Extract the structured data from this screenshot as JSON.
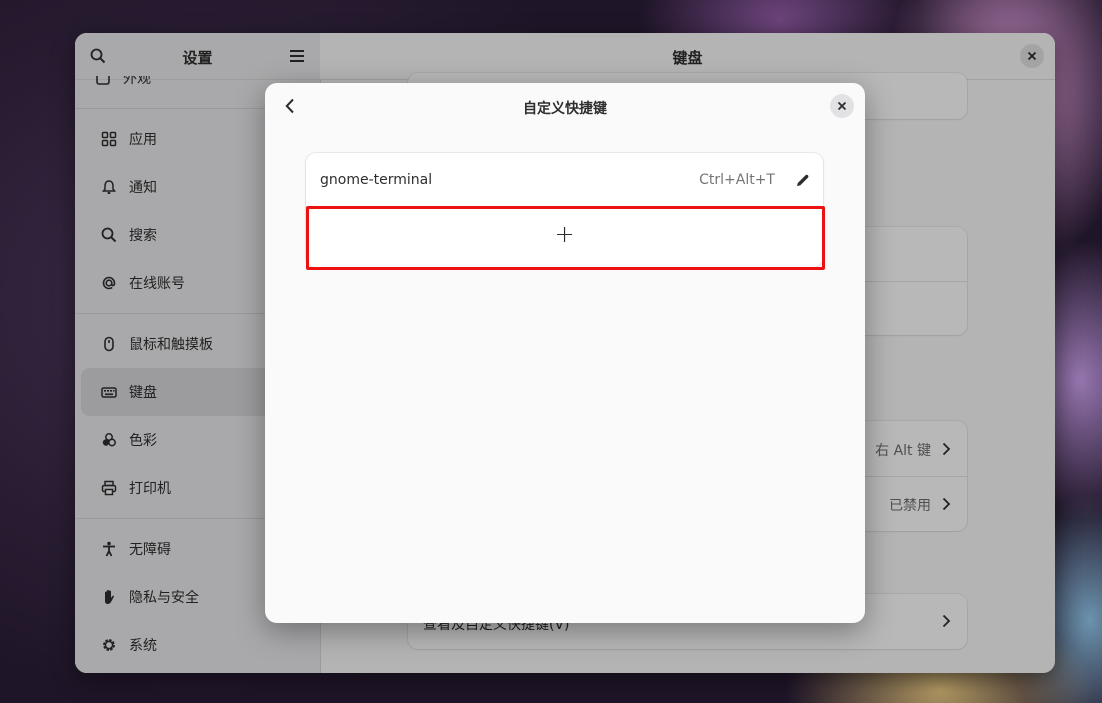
{
  "sidebar": {
    "title": "设置",
    "partial_item_label": "外观",
    "items": [
      {
        "label": "应用",
        "icon": "apps-grid-icon"
      },
      {
        "label": "通知",
        "icon": "bell-icon"
      },
      {
        "label": "搜索",
        "icon": "search-icon"
      },
      {
        "label": "在线账号",
        "icon": "at-icon"
      },
      {
        "label": "鼠标和触摸板",
        "icon": "mouse-icon"
      },
      {
        "label": "键盘",
        "icon": "keyboard-icon"
      },
      {
        "label": "色彩",
        "icon": "color-icon"
      },
      {
        "label": "打印机",
        "icon": "printer-icon"
      },
      {
        "label": "无障碍",
        "icon": "accessibility-icon"
      },
      {
        "label": "隐私与安全",
        "icon": "hand-icon"
      },
      {
        "label": "系统",
        "icon": "gear-icon"
      }
    ]
  },
  "content": {
    "title": "键盘",
    "compose_key_value": "右 Alt 键",
    "alternate_chars_value": "已禁用",
    "shortcuts_row_label": "查看及自定义快捷键(V)"
  },
  "dialog": {
    "title": "自定义快捷键",
    "shortcuts": [
      {
        "name": "gnome-terminal",
        "accel": "Ctrl+Alt+T"
      }
    ],
    "add_label": "+"
  },
  "colors": {
    "highlight": "#ee1111",
    "sidebar_bg": "#ebebed",
    "active_item_bg": "#d9d9dc"
  }
}
